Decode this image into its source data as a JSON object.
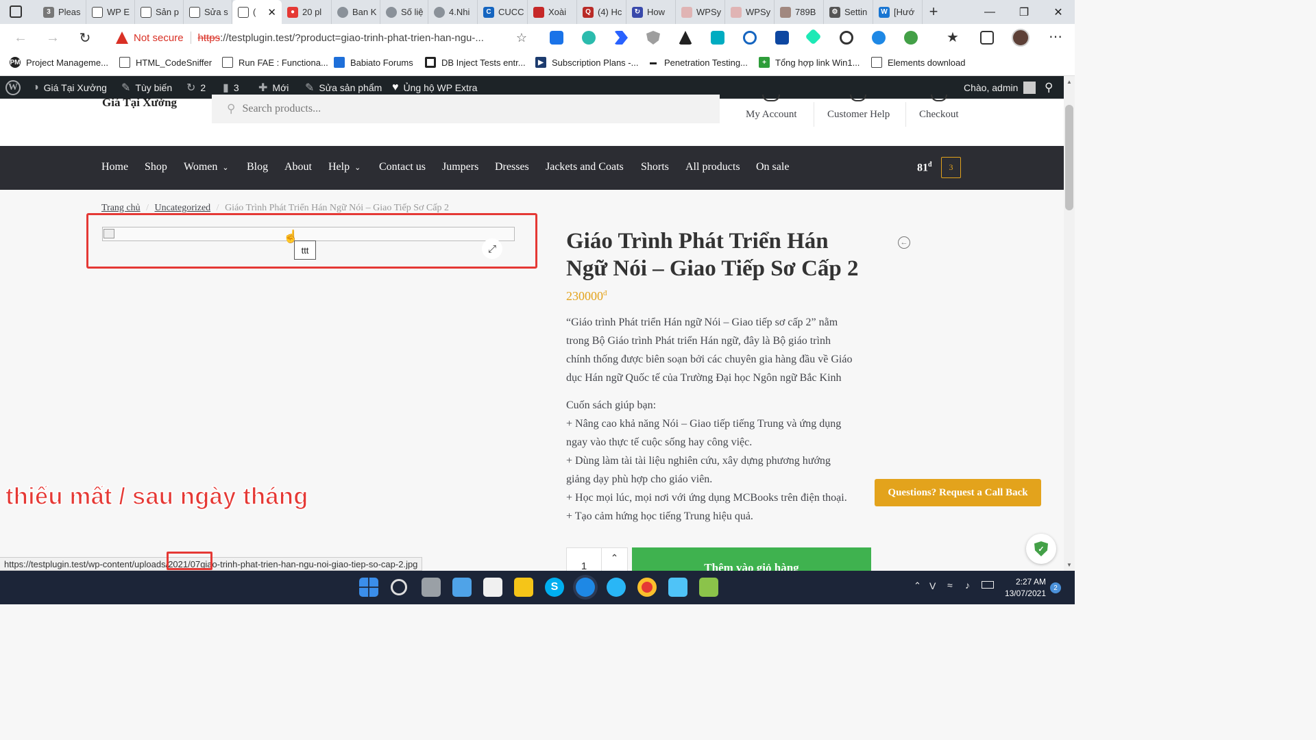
{
  "browser": {
    "tabs": [
      {
        "title": "Pleas",
        "favicon": "number-3-icon"
      },
      {
        "title": "WP E",
        "favicon": "page-icon"
      },
      {
        "title": "Sản p",
        "favicon": "page-icon"
      },
      {
        "title": "Sửa s",
        "favicon": "page-icon"
      },
      {
        "title": "(",
        "favicon": "page-icon",
        "active": true
      },
      {
        "title": "20 pl",
        "favicon": "chart-icon"
      },
      {
        "title": "Ban K",
        "favicon": "globe-icon"
      },
      {
        "title": "Số liệ",
        "favicon": "globe-icon"
      },
      {
        "title": "4.Nhi",
        "favicon": "globe-icon"
      },
      {
        "title": "CUCC",
        "favicon": "c-icon"
      },
      {
        "title": "Xoài",
        "favicon": "triangle-icon"
      },
      {
        "title": "(4) Hc",
        "favicon": "quora-icon"
      },
      {
        "title": "How",
        "favicon": "refresh-icon"
      },
      {
        "title": "WPSy",
        "favicon": "pdf-icon"
      },
      {
        "title": "WPSy",
        "favicon": "pdf-icon"
      },
      {
        "title": "789B",
        "favicon": "image-icon"
      },
      {
        "title": "Settin",
        "favicon": "gear-icon"
      },
      {
        "title": "[Hướ",
        "favicon": "w-icon"
      }
    ],
    "security_label": "Not secure",
    "url_scheme": "https",
    "url_rest": "://testplugin.test/?product=giao-trinh-phat-trien-han-ngu-...",
    "bookmarks": [
      "Project Manageme...",
      "HTML_CodeSniffer",
      "Run FAE : Functiona...",
      "Babiato Forums",
      "DB Inject Tests entr...",
      "Subscription Plans -...",
      "Penetration Testing...",
      "Tổng hợp link Win1...",
      "Elements download"
    ]
  },
  "wp_admin_bar": {
    "site_name": "Giá Tại Xưởng",
    "customize": "Tùy biến",
    "updates": "2",
    "comments": "3",
    "new": "Mới",
    "edit_product": "Sửa sản phẩm",
    "support": "Ủng hộ WP Extra",
    "greeting": "Chào, admin"
  },
  "site": {
    "logo_text": "Giá Tại Xưởng",
    "search_placeholder": "Search products...",
    "header_links": [
      "My Account",
      "Customer Help",
      "Checkout"
    ],
    "menu": [
      "Home",
      "Shop",
      "Women",
      "Blog",
      "About",
      "Help",
      "Contact us",
      "Jumpers",
      "Dresses",
      "Jackets and Coats",
      "Shorts",
      "All products",
      "On sale"
    ],
    "cart_total": "81",
    "currency": "đ",
    "cart_count": "3"
  },
  "breadcrumb": [
    "Trang chủ",
    "Uncategorized",
    "Giáo Trình Phát Triển Hán Ngữ Nói – Giao Tiếp Sơ Cấp 2"
  ],
  "gallery": {
    "tooltip": "ttt"
  },
  "product": {
    "title_line1": "Giáo Trình Phát Triển Hán",
    "title_line2": "Ngữ Nói – Giao Tiếp Sơ Cấp 2",
    "price": "230000",
    "currency": "đ",
    "desc_lines": [
      "“Giáo trình Phát triển Hán ngữ Nói – Giao tiếp sơ cấp 2” nằm",
      "trong Bộ Giáo trình Phát triển Hán ngữ, đây là Bộ giáo trình",
      "chính thống được biên soạn bởi các chuyên gia hàng đầu về Giáo",
      "dục Hán ngữ Quốc tế của Trường Đại học Ngôn ngữ Bắc Kinh"
    ],
    "benefits_heading": "Cuốn sách giúp bạn:",
    "benefit_lines": [
      "+ Nâng cao khả năng Nói – Giao tiếp tiếng Trung và ứng dụng",
      "ngay vào thực tế cuộc sống hay công việc.",
      "+ Dùng làm tài tài liệu nghiên cứu, xây dựng phương hướng",
      "giảng dạy phù hợp cho giáo viên.",
      "+ Học mọi lúc, mọi nơi với ứng dụng MCBooks trên điện thoại.",
      "+ Tạo cảm hứng học tiếng Trung hiệu quả."
    ],
    "quantity": "1",
    "add_to_cart": "Thêm vào giỏ hàng"
  },
  "callback_button": "Questions? Request a Call Back",
  "annotation_text": "thiếu mất / sau ngày tháng",
  "status_url": "https://testplugin.test/wp-content/uploads/2021/07giao-trinh-phat-trien-han-ngu-noi-giao-tiep-so-cap-2.jpg",
  "taskbar": {
    "time": "2:27 AM",
    "date": "13/07/2021",
    "notifications": "2"
  },
  "colors": {
    "accent": "#e3a31c",
    "annotation_red": "#e53935",
    "cart_green": "#3fb24f",
    "admin_bar": "#1d2327",
    "nav_menu": "#2c2d33"
  }
}
